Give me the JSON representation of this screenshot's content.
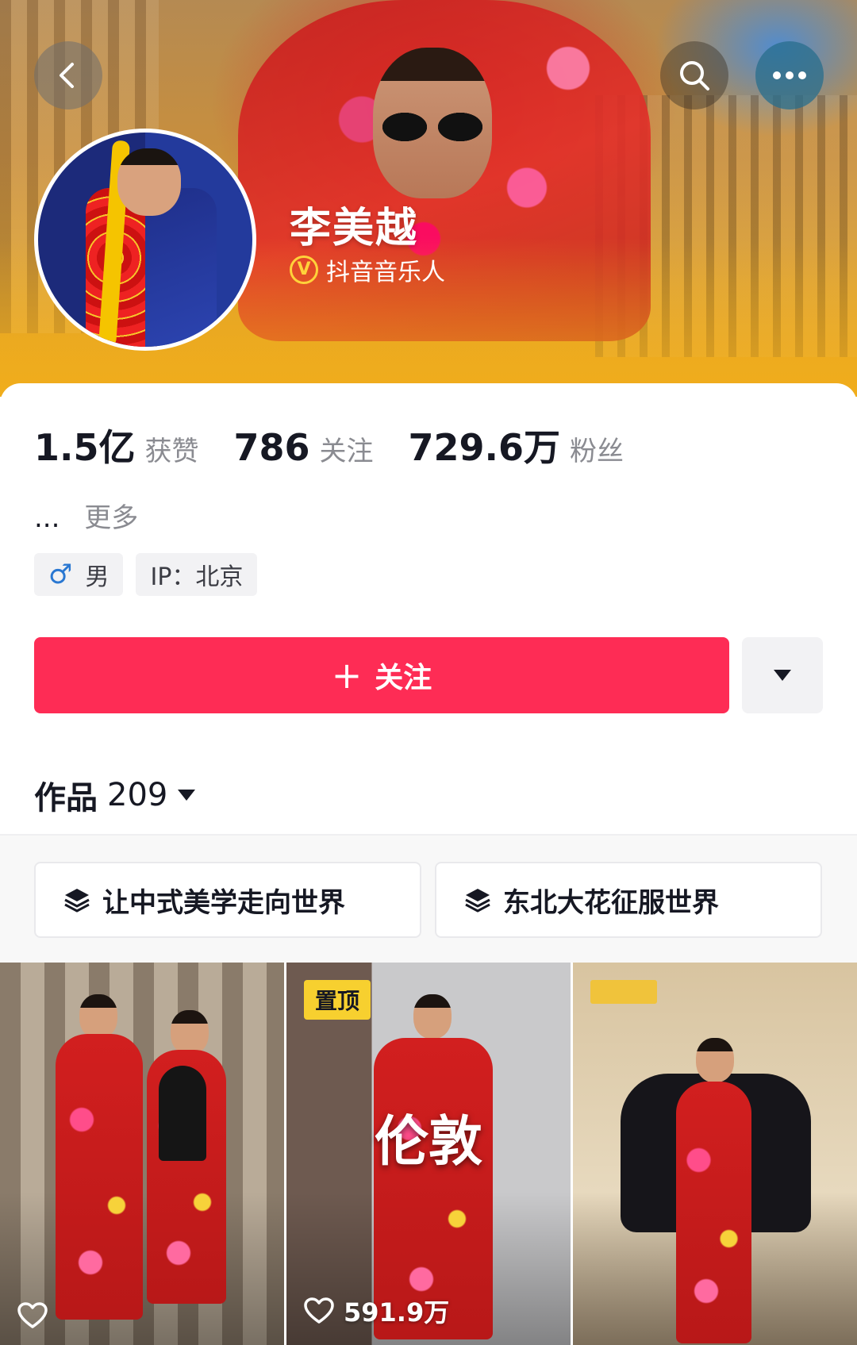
{
  "profile": {
    "name": "李美越",
    "verification": "抖音音乐人",
    "verify_icon_glyph": "V"
  },
  "stats": [
    {
      "value": "1.5亿",
      "label": "获赞"
    },
    {
      "value": "786",
      "label": "关注"
    },
    {
      "value": "729.6万",
      "label": "粉丝"
    }
  ],
  "bio": {
    "ellipsis": "...",
    "more_label": "更多"
  },
  "tags": {
    "gender_symbol": "♂",
    "gender": "男",
    "ip": "IP：北京"
  },
  "actions": {
    "follow_plus": "+",
    "follow_label": "关注"
  },
  "works": {
    "label": "作品",
    "count": "209"
  },
  "collections": [
    {
      "title": "让中式美学走向世界",
      "icon": "layers-icon"
    },
    {
      "title": "东北大花征服世界",
      "icon": "layers-icon"
    }
  ],
  "videos": [
    {
      "likes": ""
    },
    {
      "pinned_label": "置顶",
      "overlay_title": "伦敦",
      "likes": "591.9万"
    },
    {
      "likes": ""
    }
  ],
  "colors": {
    "accent": "#fe2c55",
    "pin_badge": "#f7d02f",
    "banner_warm": "#f0ad1c",
    "verify_gold": "#ffd23a"
  }
}
